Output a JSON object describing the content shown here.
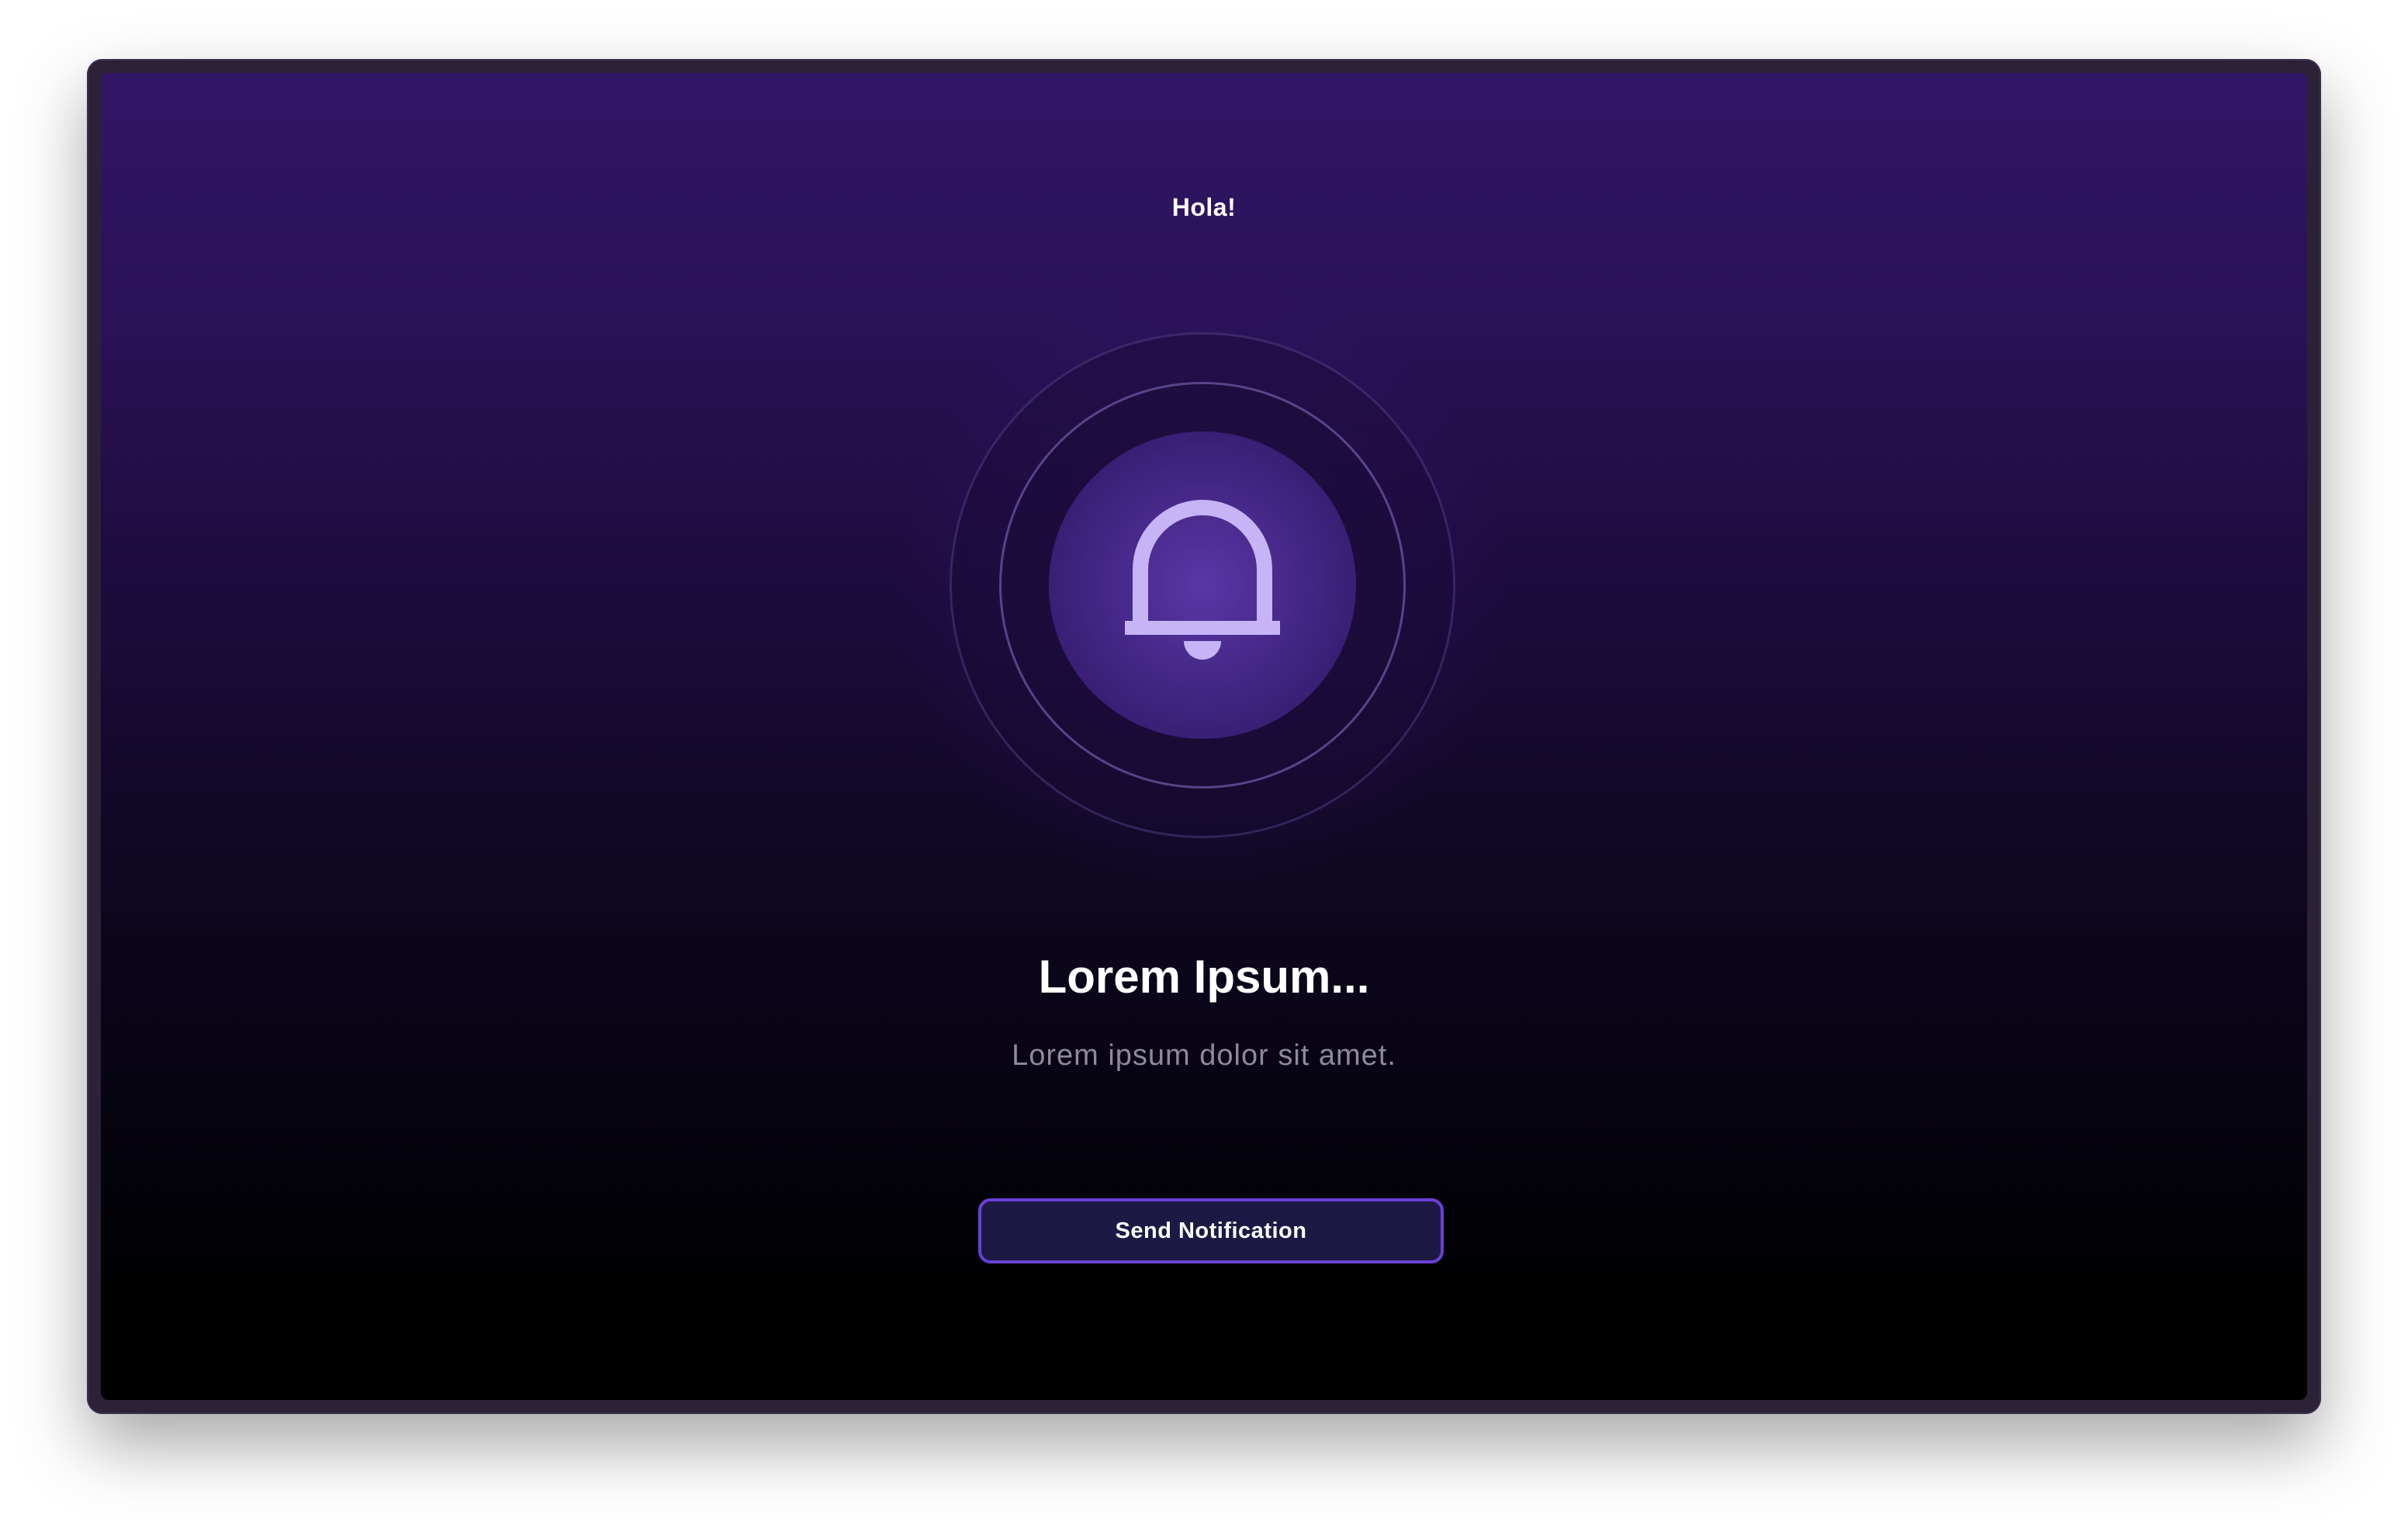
{
  "screen": {
    "greeting": "Hola!",
    "title": "Lorem Ipsum...",
    "subtitle": "Lorem ipsum dolor sit amet.",
    "button_label": "Send Notification"
  },
  "icons": {
    "center": "bell-icon"
  },
  "colors": {
    "background_top": "#311666",
    "background_bottom": "#000000",
    "icon": "#c6b4f7",
    "button_border": "#6a3fd6",
    "button_fill": "#1c1a44",
    "subtitle": "#8e8a99"
  }
}
